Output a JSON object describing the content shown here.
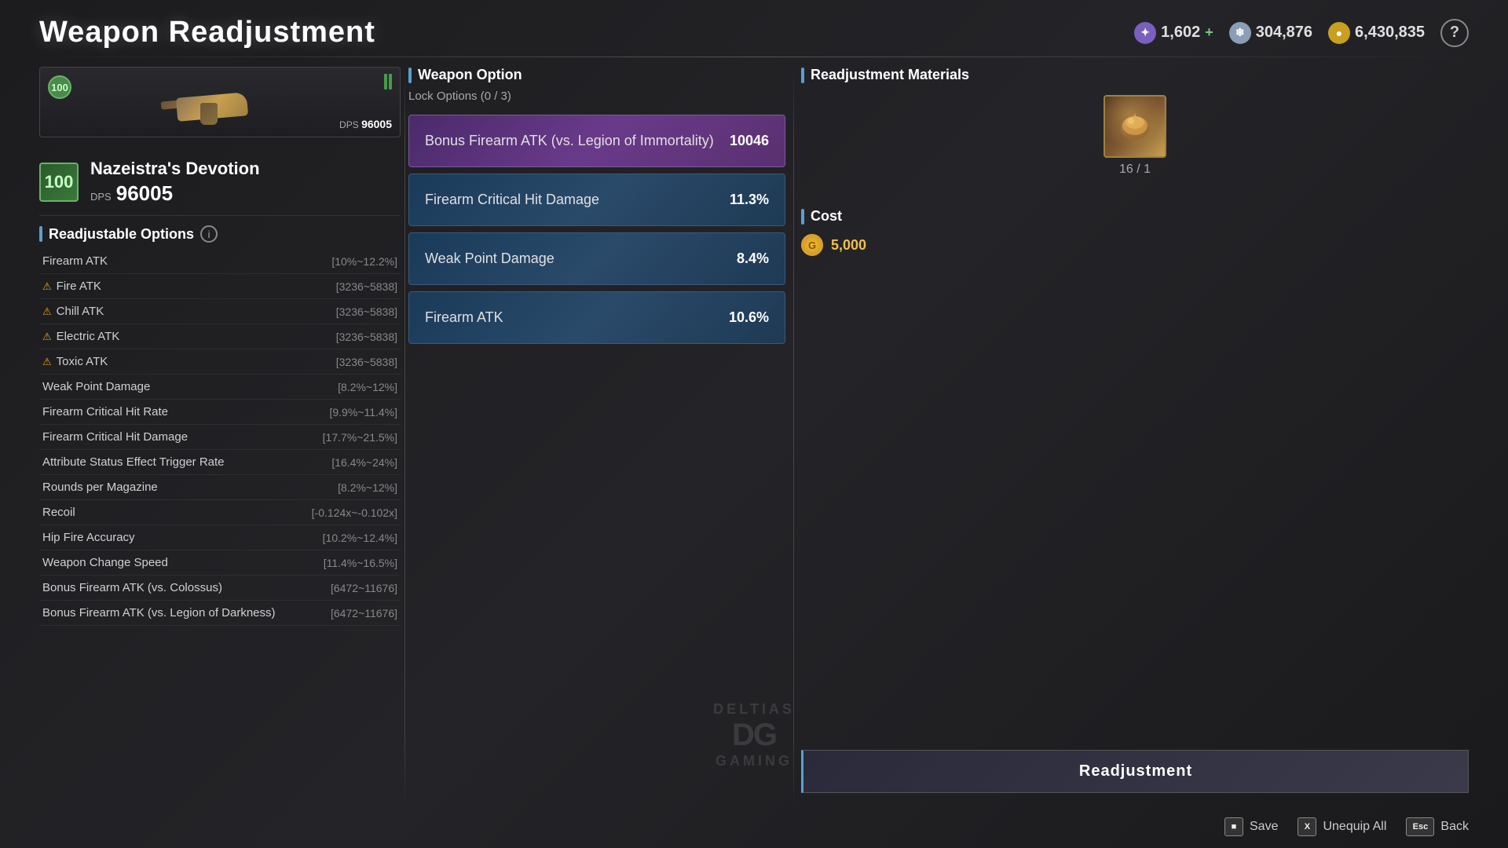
{
  "header": {
    "title": "Weapon Readjustment",
    "currency1": {
      "value": "1,602",
      "has_plus": true,
      "type": "purple"
    },
    "currency2": {
      "value": "304,876",
      "type": "silver"
    },
    "currency3": {
      "value": "6,430,835",
      "type": "gold"
    }
  },
  "weapon": {
    "level": "100",
    "name": "Nazeistra's Devotion",
    "dps_label": "DPS",
    "dps_value": "96005",
    "dps_card": "96005"
  },
  "readjustable_options": {
    "title": "Readjustable Options",
    "items": [
      {
        "name": "Firearm ATK",
        "range": "[10%~12.2%]",
        "warning": false
      },
      {
        "name": "Fire ATK",
        "range": "[3236~5838]",
        "warning": true
      },
      {
        "name": "Chill ATK",
        "range": "[3236~5838]",
        "warning": true
      },
      {
        "name": "Electric ATK",
        "range": "[3236~5838]",
        "warning": true
      },
      {
        "name": "Toxic ATK",
        "range": "[3236~5838]",
        "warning": true
      },
      {
        "name": "Weak Point Damage",
        "range": "[8.2%~12%]",
        "warning": false
      },
      {
        "name": "Firearm Critical Hit Rate",
        "range": "[9.9%~11.4%]",
        "warning": false
      },
      {
        "name": "Firearm Critical Hit Damage",
        "range": "[17.7%~21.5%]",
        "warning": false
      },
      {
        "name": "Attribute Status Effect Trigger Rate",
        "range": "[16.4%~24%]",
        "warning": false
      },
      {
        "name": "Rounds per Magazine",
        "range": "[8.2%~12%]",
        "warning": false
      },
      {
        "name": "Recoil",
        "range": "[-0.124x~-0.102x]",
        "warning": false
      },
      {
        "name": "Hip Fire Accuracy",
        "range": "[10.2%~12.4%]",
        "warning": false
      },
      {
        "name": "Weapon Change Speed",
        "range": "[11.4%~16.5%]",
        "warning": false
      },
      {
        "name": "Bonus Firearm ATK (vs. Colossus)",
        "range": "[6472~11676]",
        "warning": false
      },
      {
        "name": "Bonus Firearm ATK (vs. Legion of Darkness)",
        "range": "[6472~11676]",
        "warning": false
      }
    ]
  },
  "weapon_options": {
    "title": "Weapon Option",
    "lock_label": "Lock Options (0 / 3)",
    "options": [
      {
        "name": "Bonus Firearm ATK (vs. Legion of Immortality)",
        "value": "10046",
        "style": "purple"
      },
      {
        "name": "Firearm Critical Hit Damage",
        "value": "11.3%",
        "style": "blue"
      },
      {
        "name": "Weak Point Damage",
        "value": "8.4%",
        "style": "blue"
      },
      {
        "name": "Firearm ATK",
        "value": "10.6%",
        "style": "blue"
      }
    ]
  },
  "readjustment_materials": {
    "title": "Readjustment Materials",
    "count_label": "16 / 1"
  },
  "cost": {
    "title": "Cost",
    "value": "5,000"
  },
  "buttons": {
    "readjustment": "Readjustment",
    "save": "Save",
    "unequip_all": "Unequip All",
    "back": "Back"
  },
  "watermark": {
    "brand": "DELTIAS",
    "logo": "DG",
    "sub": "GAMING"
  }
}
